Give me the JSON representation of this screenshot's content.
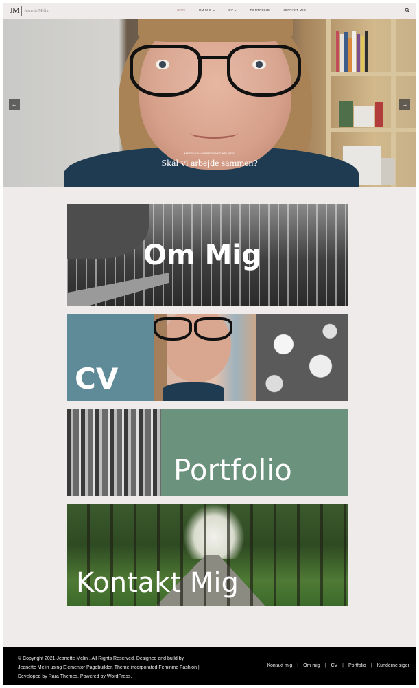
{
  "header": {
    "logo_mark": "JM",
    "logo_name": "Jeanette Melin",
    "nav": [
      {
        "label": "HOME",
        "active": true
      },
      {
        "label": "OM MIG ⌄",
        "active": false
      },
      {
        "label": "CV ⌄",
        "active": false
      },
      {
        "label": "PORTFOLIO",
        "active": false
      },
      {
        "label": "KONTAKT MIG",
        "active": false
      }
    ],
    "search_icon": "search-icon"
  },
  "hero": {
    "tag": "MEDIEGRAFIKERPRAKTIKPLADS",
    "title": "Skal vi arbejde sammen?",
    "prev_arrow": "←",
    "next_arrow": "→"
  },
  "tiles": [
    {
      "label": "Om Mig"
    },
    {
      "label": "CV"
    },
    {
      "label": "Portfolio"
    },
    {
      "label": "Kontakt Mig"
    }
  ],
  "footer": {
    "copyright_lines": [
      "© Copyright 2021 Jeanette Melin . All Rights Reserved. Designed and build by",
      "Jeanette Melin using Elementor Pagebuilder. Theme incorporated Feminine Fashion |",
      "Developed by Rara Themes. Powered by WordPress."
    ],
    "nav": [
      "Kontakt mig",
      "Om mig",
      "CV",
      "Portfolio",
      "Kunderne siger"
    ]
  },
  "colors": {
    "page_bg": "#f0ebeb",
    "cv_block": "#5f8a97",
    "portfolio_block": "#6b927c",
    "footer_bg": "#000000"
  }
}
